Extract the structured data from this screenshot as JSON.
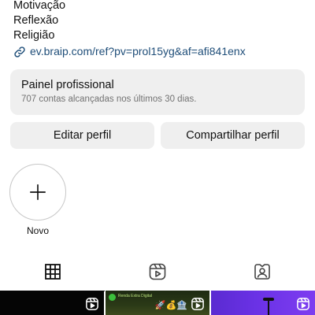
{
  "bio": {
    "lines": [
      "Motivação",
      "Reflexão",
      "Religião"
    ],
    "link": "ev.braip.com/ref?pv=prol15yg&af=afi841enx"
  },
  "professional_panel": {
    "title": "Painel profissional",
    "subtitle": "707 contas alcançadas nos últimos 30 dias."
  },
  "buttons": {
    "edit_profile": "Editar perfil",
    "share_profile": "Compartilhar perfil"
  },
  "highlights": {
    "new_label": "Novo"
  },
  "tabs": [
    {
      "icon": "grid-icon",
      "active": true
    },
    {
      "icon": "reels-icon",
      "active": false
    },
    {
      "icon": "tagged-icon",
      "active": false
    }
  ],
  "posts": [
    {
      "type": "reel",
      "icon": "reel-badge-icon"
    },
    {
      "type": "reel",
      "icon": "reel-badge-icon",
      "emoji": "🚀💰🏦",
      "caption": "Renda Extra Digital"
    },
    {
      "type": "reel",
      "icon": "reel-badge-icon"
    }
  ]
}
